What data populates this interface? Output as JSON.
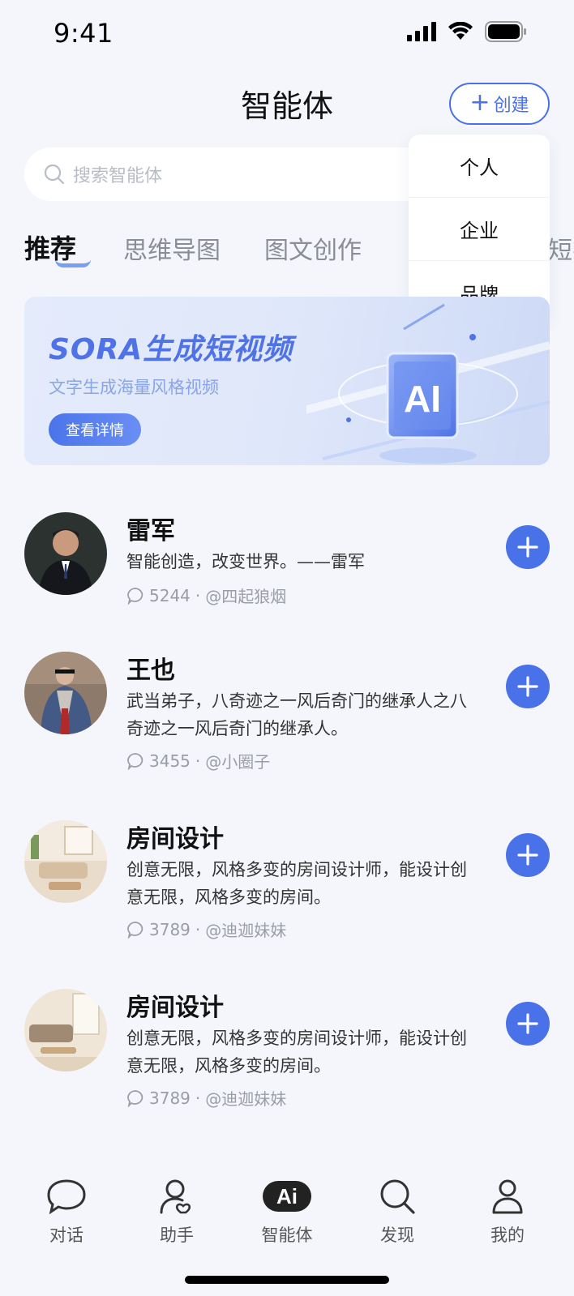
{
  "status_bar": {
    "time": "9:41"
  },
  "header": {
    "title": "智能体",
    "create_label": "创建"
  },
  "dropdown": {
    "items": [
      "个人",
      "企业",
      "品牌"
    ]
  },
  "search": {
    "placeholder": "搜索智能体"
  },
  "tabs": [
    {
      "label": "推荐",
      "active": true
    },
    {
      "label": "思维导图",
      "active": false
    },
    {
      "label": "图文创作",
      "active": false
    },
    {
      "label": "短视",
      "active": false
    }
  ],
  "banner": {
    "title": "SORA生成短视频",
    "subtitle": "文字生成海量风格视频",
    "button": "查看详情",
    "art_text": "AI"
  },
  "agents": [
    {
      "name": "雷军",
      "desc": "智能创造，改变世界。——雷军",
      "count": "5244",
      "author": "@四起狼烟"
    },
    {
      "name": "王也",
      "desc": "武当弟子，八奇迹之一风后奇门的继承人之八奇迹之一风后奇门的继承人。",
      "count": "3455",
      "author": "@小圈子"
    },
    {
      "name": "房间设计",
      "desc": "创意无限，风格多变的房间设计师，能设计创意无限，风格多变的房间。",
      "count": "3789",
      "author": "@迪迦妹妹"
    },
    {
      "name": "房间设计",
      "desc": "创意无限，风格多变的房间设计师，能设计创意无限，风格多变的房间。",
      "count": "3789",
      "author": "@迪迦妹妹"
    }
  ],
  "meta_separator": "·",
  "tabbar": [
    {
      "label": "对话",
      "icon": "chat-icon"
    },
    {
      "label": "助手",
      "icon": "assistant-icon"
    },
    {
      "label": "智能体",
      "icon": "ai-icon",
      "icon_text": "Ai"
    },
    {
      "label": "发现",
      "icon": "search-icon"
    },
    {
      "label": "我的",
      "icon": "profile-icon"
    }
  ],
  "colors": {
    "accent": "#4a72e8",
    "background": "#f4f6fb"
  }
}
